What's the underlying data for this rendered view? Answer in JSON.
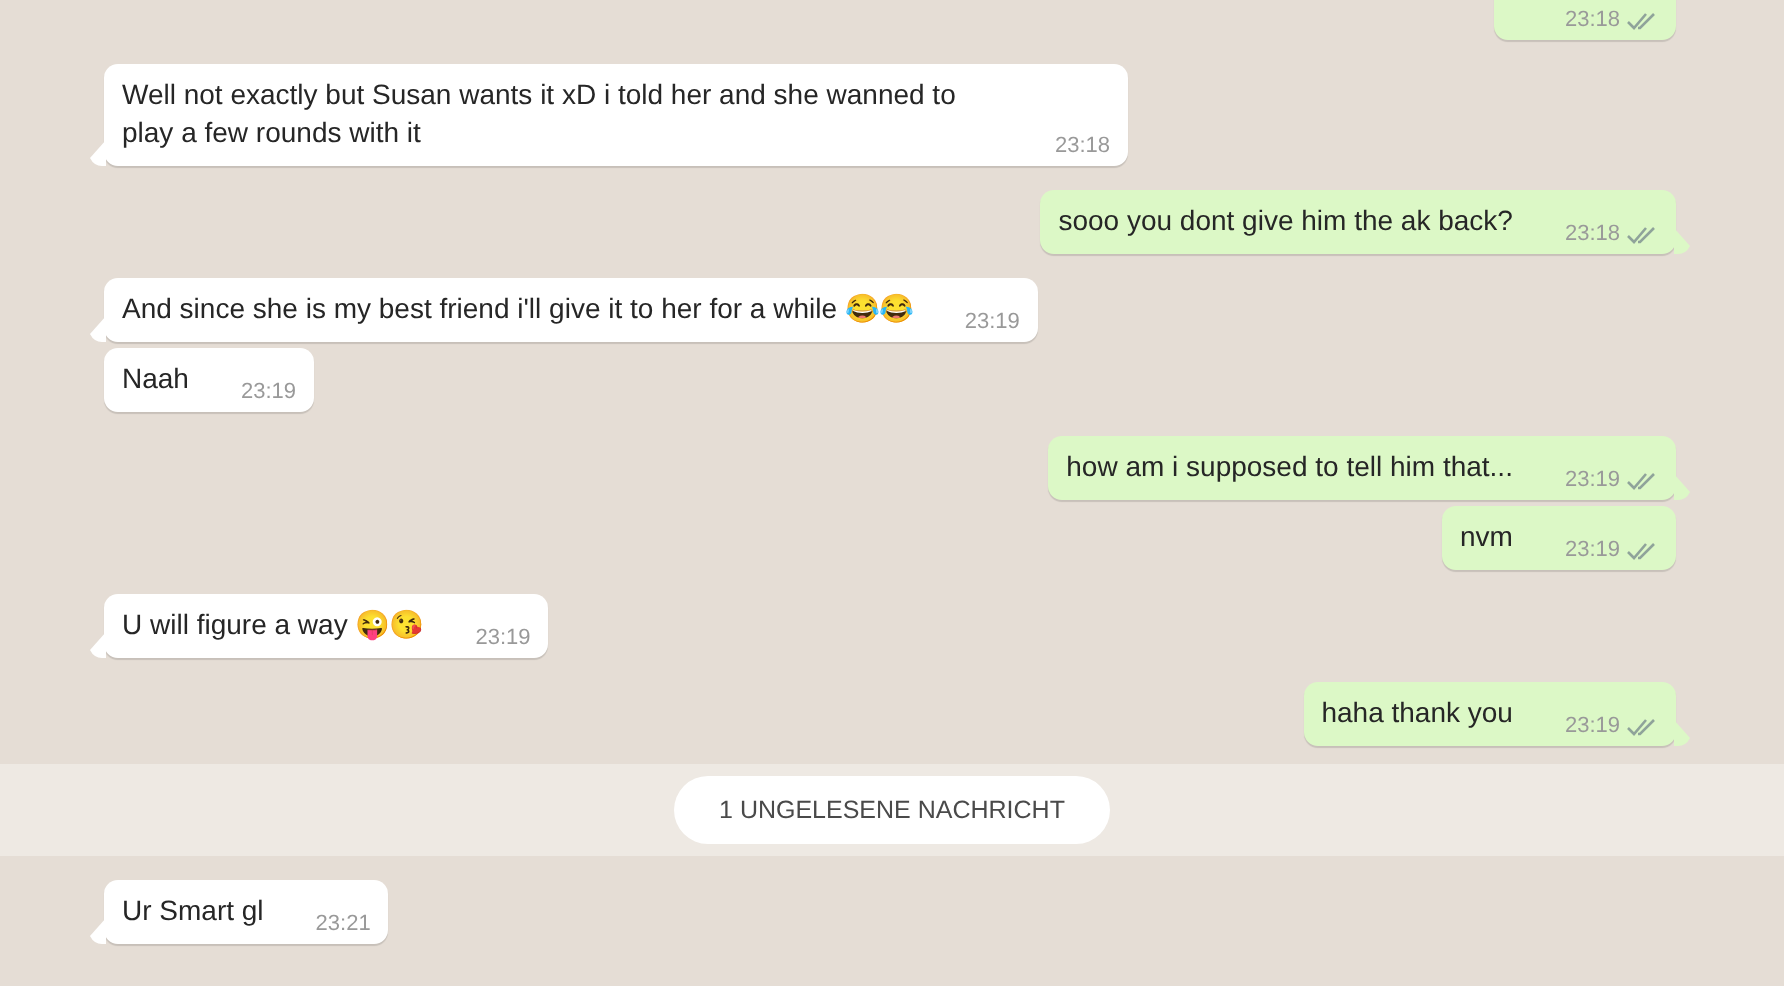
{
  "messages": [
    {
      "kind": "out",
      "tail": false,
      "time": "23:18"
    },
    {
      "kind": "in",
      "tail": true,
      "text": "Well not exactly but Susan wants it xD i told her and she wanned to play a few rounds with it",
      "time": "23:18"
    },
    {
      "kind": "out",
      "tail": true,
      "text": "sooo you dont give him the ak back?",
      "time": "23:18"
    },
    {
      "kind": "in",
      "tail": true,
      "text": "And since she is my best friend i'll give it to her for a while 😂😂",
      "time": "23:19"
    },
    {
      "kind": "in",
      "tail": false,
      "text": "Naah",
      "time": "23:19"
    },
    {
      "kind": "out",
      "tail": true,
      "text": "how am i supposed to tell him that...",
      "time": "23:19"
    },
    {
      "kind": "out",
      "tail": false,
      "text": "nvm",
      "time": "23:19"
    },
    {
      "kind": "in",
      "tail": true,
      "text": "U will figure a way 😜😘",
      "time": "23:19"
    },
    {
      "kind": "out",
      "tail": true,
      "text": "haha thank you",
      "time": "23:19"
    },
    {
      "kind": "unread",
      "text": "1 UNGELESENE NACHRICHT"
    },
    {
      "kind": "in",
      "tail": true,
      "text": "Ur Smart gl",
      "time": "23:21"
    }
  ]
}
